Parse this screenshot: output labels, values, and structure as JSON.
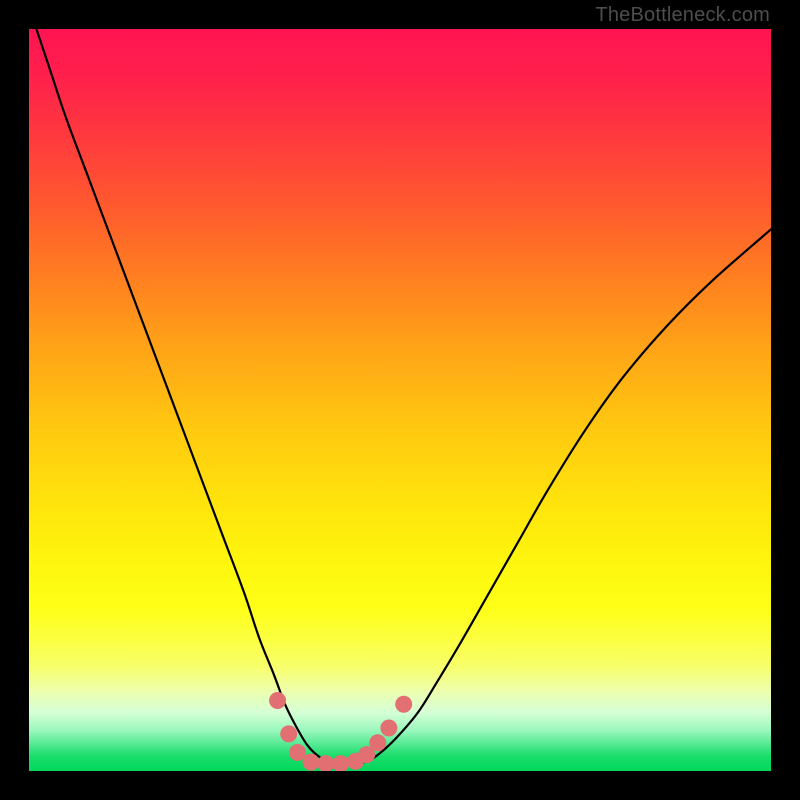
{
  "watermark": "TheBottleneck.com",
  "colors": {
    "background": "#000000",
    "curve_stroke": "#000000",
    "marker_fill": "#e26f72",
    "gradient_top": "#ff1452",
    "gradient_bottom": "#00d85c"
  },
  "chart_data": {
    "type": "line",
    "title": "",
    "xlabel": "",
    "ylabel": "",
    "xlim": [
      0,
      100
    ],
    "ylim": [
      0,
      100
    ],
    "series": [
      {
        "name": "bottleneck-curve",
        "x": [
          1,
          3,
          5,
          8,
          11,
          14,
          17,
          20,
          23,
          26,
          29,
          31,
          33,
          34.5,
          36,
          37.5,
          39,
          40.5,
          42,
          44,
          46,
          48,
          50,
          52.5,
          55,
          58,
          62,
          66,
          70,
          75,
          80,
          86,
          92,
          100
        ],
        "y": [
          100,
          94,
          88,
          80,
          72,
          64,
          56,
          48,
          40,
          32,
          24,
          18,
          13,
          9,
          6,
          3.5,
          2,
          1.2,
          1,
          1,
          1.5,
          3,
          5,
          8,
          12,
          17,
          24,
          31,
          38,
          46,
          53,
          60,
          66,
          73
        ]
      }
    ],
    "markers": {
      "name": "highlighted-points",
      "points": [
        {
          "x": 33.5,
          "y": 9.5
        },
        {
          "x": 35,
          "y": 5.0
        },
        {
          "x": 36.2,
          "y": 2.5
        },
        {
          "x": 38,
          "y": 1.2
        },
        {
          "x": 40,
          "y": 1.0
        },
        {
          "x": 42,
          "y": 1.0
        },
        {
          "x": 44,
          "y": 1.3
        },
        {
          "x": 45.5,
          "y": 2.2
        },
        {
          "x": 47,
          "y": 3.8
        },
        {
          "x": 48.5,
          "y": 5.8
        },
        {
          "x": 50.5,
          "y": 9.0
        }
      ]
    }
  }
}
